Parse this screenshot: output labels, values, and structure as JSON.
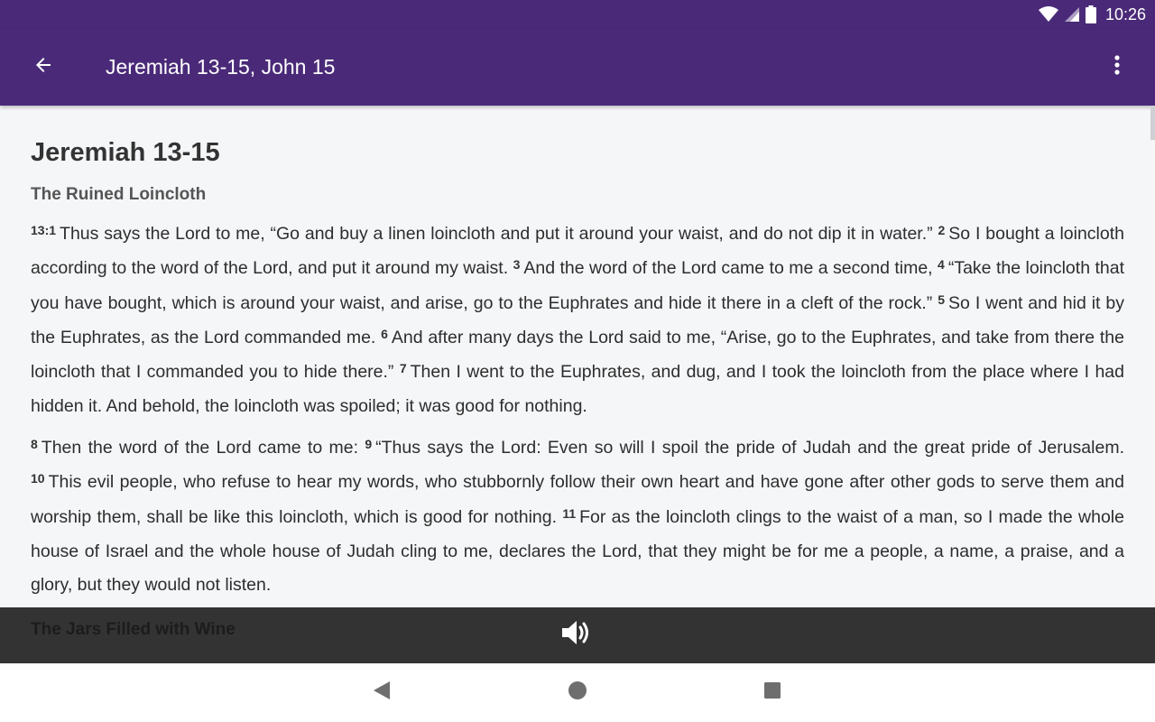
{
  "status_bar": {
    "time": "10:26"
  },
  "app_bar": {
    "title": "Jeremiah 13-15, John 15"
  },
  "content": {
    "book_title": "Jeremiah 13-15",
    "section1_heading": "The Ruined Loincloth",
    "para1": [
      {
        "num": "13:1",
        "text": "Thus says the Lord to me, “Go and buy a linen loincloth and put it around your waist, and do not dip it in water.”"
      },
      {
        "num": "2",
        "text": "So I bought a loincloth according to the word of the Lord, and put it around my waist."
      },
      {
        "num": "3",
        "text": "And the word of the Lord came to me a second time,"
      },
      {
        "num": "4",
        "text": "“Take the loincloth that you have bought, which is around your waist, and arise, go to the Euphrates and hide it there in a cleft of the rock.”"
      },
      {
        "num": "5",
        "text": "So I went and hid it by the Euphrates, as the Lord commanded me."
      },
      {
        "num": "6",
        "text": "And after many days the Lord said to me, “Arise, go to the Euphrates, and take from there the loincloth that I commanded you to hide there.”"
      },
      {
        "num": "7",
        "text": "Then I went to the Euphrates, and dug, and I took the loincloth from the place where I had hidden it. And behold, the loincloth was spoiled; it was good for nothing."
      }
    ],
    "para2": [
      {
        "num": "8",
        "text": "Then the word of the Lord came to me:"
      },
      {
        "num": "9",
        "text": "“Thus says the Lord: Even so will I spoil the pride of Judah and the great pride of Jerusalem."
      },
      {
        "num": "10",
        "text": "This evil people, who refuse to hear my words, who stubbornly follow their own heart and have gone after other gods to serve them and worship them, shall be like this loincloth, which is good for nothing."
      },
      {
        "num": "11",
        "text": "For as the loincloth clings to the waist of a man, so I made the whole house of Israel and the whole house of Judah cling to me, declares the Lord, that they might be for me a people, a name, a praise, and a glory, but they would not listen."
      }
    ],
    "section2_heading": "The Jars Filled with Wine"
  },
  "icons": {
    "back": "arrow-back-icon",
    "more": "more-vert-icon",
    "speaker": "volume-up-icon",
    "nav_back": "triangle-back-icon",
    "nav_home": "circle-home-icon",
    "nav_recent": "square-recent-icon"
  },
  "colors": {
    "app_bar": "#4a2a78",
    "audio_bar": "#333333",
    "background": "#f5f6f8"
  }
}
